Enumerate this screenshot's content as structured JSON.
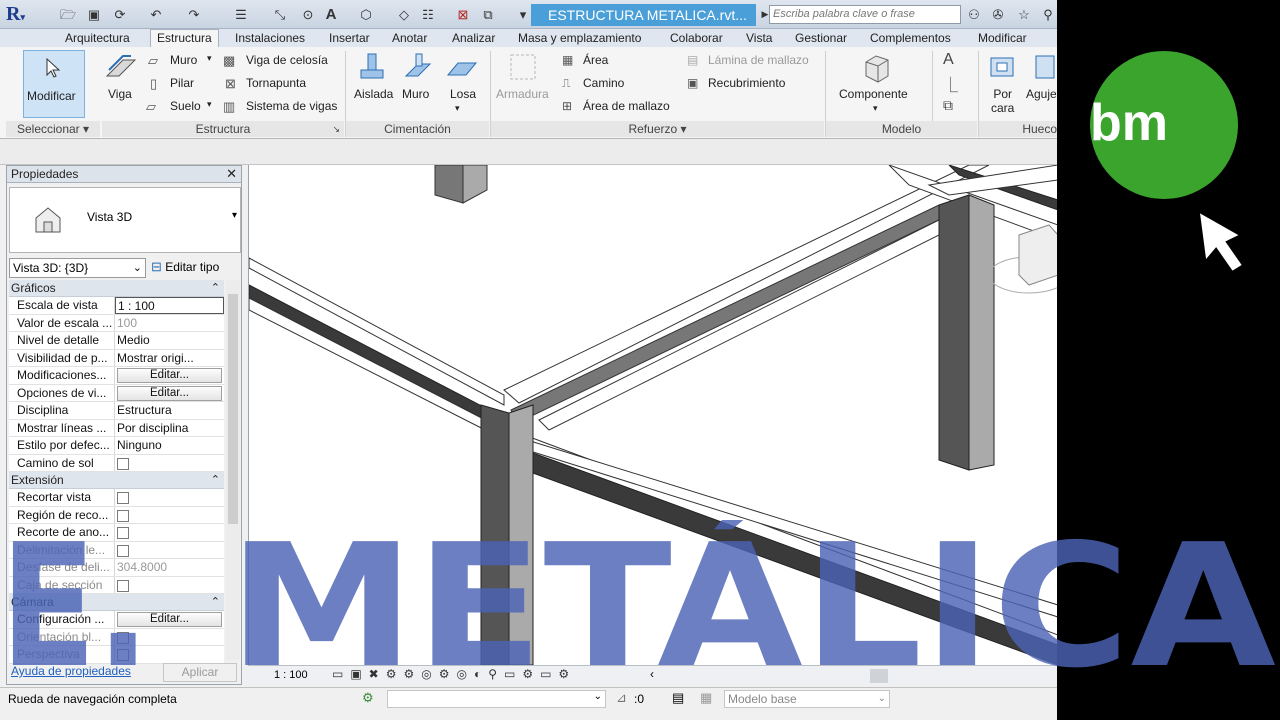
{
  "app": {
    "title": "ESTRUCTURA METALICA.rvt...",
    "search_placeholder": "Escriba palabra clave o frase",
    "logo": "R"
  },
  "tabs": [
    "Arquitectura",
    "Estructura",
    "Instalaciones",
    "Insertar",
    "Anotar",
    "Analizar",
    "Masa y emplazamiento",
    "Colaborar",
    "Vista",
    "Gestionar",
    "Complementos",
    "Modificar"
  ],
  "ribbon": {
    "modificar": "Modificar",
    "viga": "Viga",
    "muro": "Muro",
    "pilar": "Pilar",
    "suelo": "Suelo",
    "viga_celosia": "Viga de celosía",
    "tornapunta": "Tornapunta",
    "sistema_vigas": "Sistema de vigas",
    "aislada": "Aislada",
    "muro_cim": "Muro",
    "losa": "Losa",
    "armadura": "Armadura",
    "area": "Área",
    "camino": "Camino",
    "area_mallazo": "Área  de mallazo",
    "lamina_mallazo": "Lámina  de mallazo",
    "recubrimiento": "Recubrimiento",
    "componente": "Componente",
    "por_cara": "Por cara",
    "agujero": "Aguje",
    "panels": {
      "seleccionar": "Seleccionar",
      "estructura": "Estructura",
      "cimentacion": "Cimentación",
      "refuerzo": "Refuerzo",
      "modelo": "Modelo",
      "hueco": "Hueco"
    }
  },
  "properties": {
    "title": "Propiedades",
    "type_name": "Vista 3D",
    "instance": "Vista 3D: {3D}",
    "edit_type": "Editar tipo",
    "sections": {
      "graficos": "Gráficos",
      "extension": "Extensión",
      "camara": "Cámara"
    },
    "graficos_rows": [
      {
        "k": "Escala de vista",
        "v": "1 : 100"
      },
      {
        "k": "Valor de escala ...",
        "v": "100"
      },
      {
        "k": "Nivel de detalle",
        "v": "Medio"
      },
      {
        "k": "Visibilidad de p...",
        "v": "Mostrar origi..."
      },
      {
        "k": "Modificaciones...",
        "v": "Editar..."
      },
      {
        "k": "Opciones de vi...",
        "v": "Editar..."
      },
      {
        "k": "Disciplina",
        "v": "Estructura"
      },
      {
        "k": "Mostrar líneas ...",
        "v": "Por disciplina"
      },
      {
        "k": "Estilo por defec...",
        "v": "Ninguno"
      },
      {
        "k": "Camino de sol",
        "v": ""
      }
    ],
    "extension_rows": [
      {
        "k": "Recortar vista",
        "v": ""
      },
      {
        "k": "Región de reco...",
        "v": ""
      },
      {
        "k": "Recorte de ano...",
        "v": ""
      },
      {
        "k": "Delimitación le...",
        "v": ""
      },
      {
        "k": "Desfase de deli...",
        "v": "304.8000"
      },
      {
        "k": "Caja de sección",
        "v": ""
      }
    ],
    "camara_rows": [
      {
        "k": "Configuración ...",
        "v": "Editar..."
      },
      {
        "k": "Orientación bl...",
        "v": ""
      },
      {
        "k": "Perspectiva",
        "v": ""
      }
    ],
    "help_link": "Ayuda de propiedades",
    "apply": "Aplicar"
  },
  "viewbar": {
    "scale": "1 : 100"
  },
  "status": {
    "text": "Rueda de navegación completa",
    "count": ":0",
    "model": "Modelo base"
  },
  "overlay": {
    "title_left": "E.",
    "title_main": "METÁLICA",
    "brand": "bm"
  },
  "colors": {
    "accent_blue": "#4a9fd8",
    "overlay_text": "#4a63b4",
    "brand_green": "#3aa42d"
  }
}
